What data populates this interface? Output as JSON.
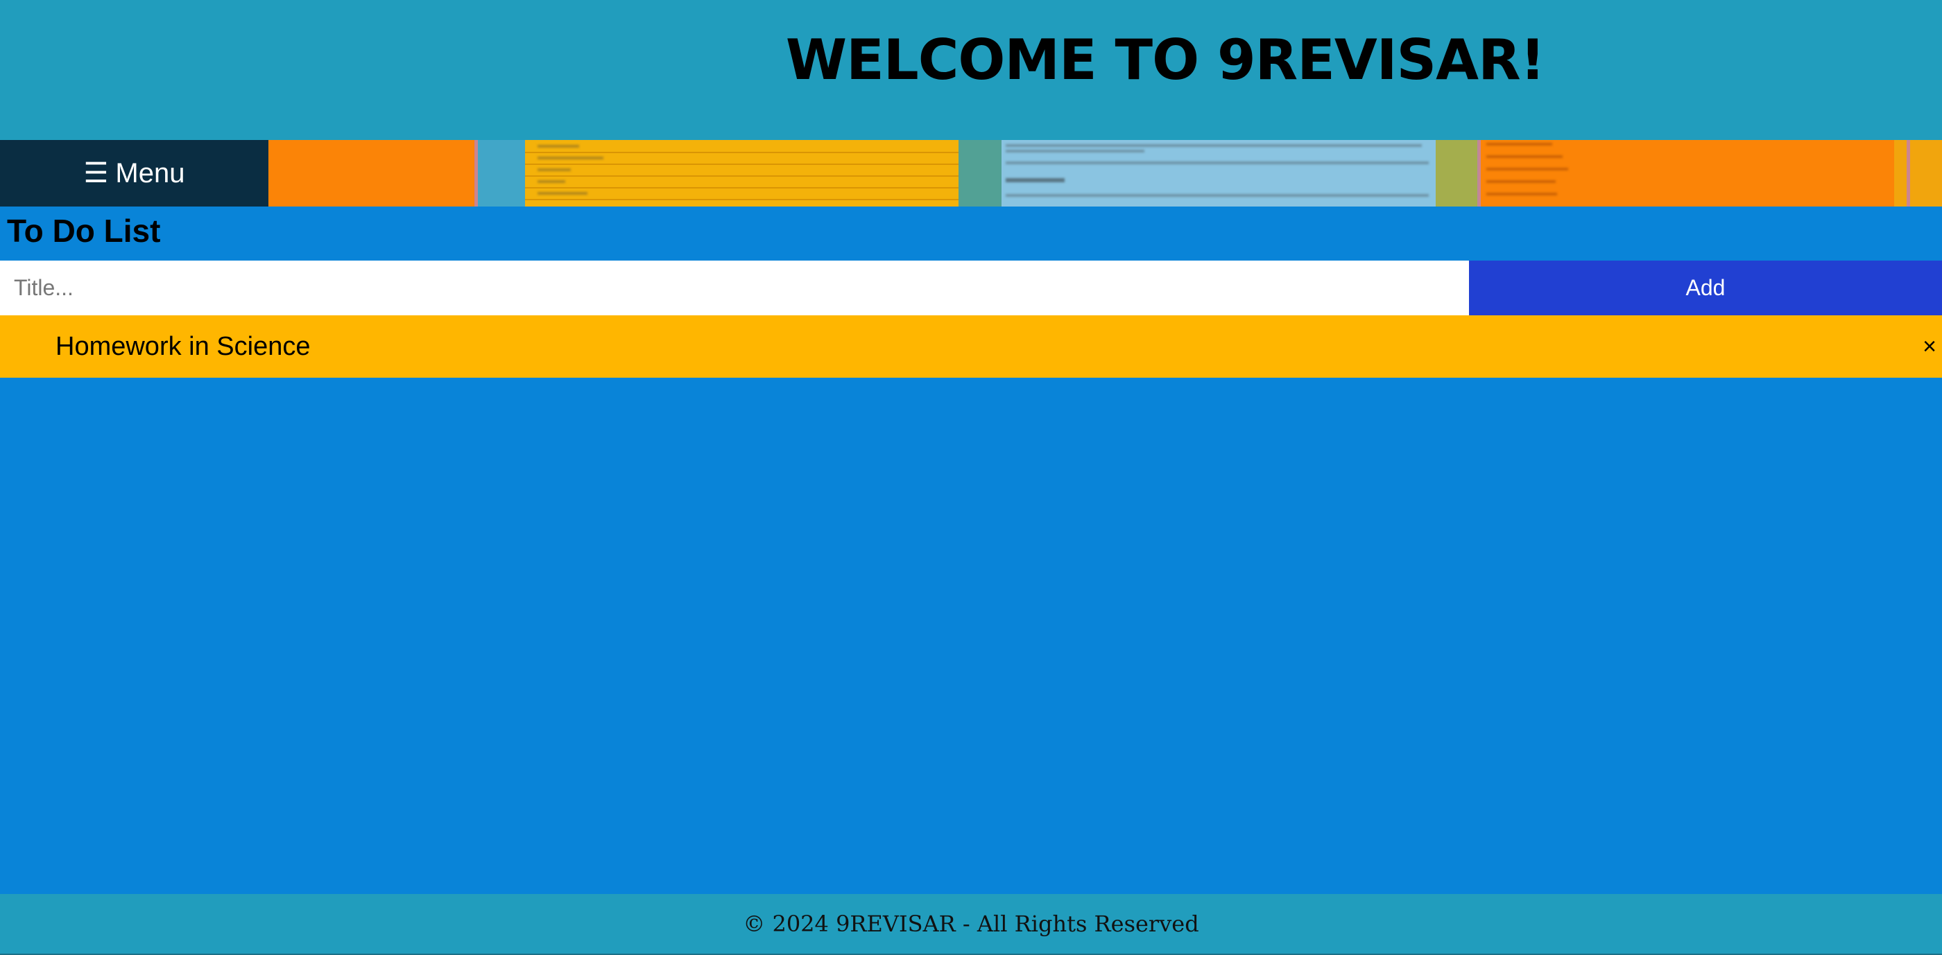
{
  "header": {
    "title": "WELCOME TO 9REVISAR!"
  },
  "nav": {
    "menu_icon": "☰",
    "menu_label": "Menu"
  },
  "todo": {
    "heading": "To Do List",
    "input_placeholder": "Title...",
    "input_value": "",
    "add_label": "Add",
    "items": [
      {
        "text": "Homework in Science",
        "close_symbol": "×"
      }
    ]
  },
  "footer": {
    "text": "© 2024 9REVISAR - All Rights Reserved"
  },
  "colors": {
    "header_bg": "#219dbd",
    "page_bg": "#0984d8",
    "menu_bg": "#0a2d42",
    "add_button_bg": "#2140d2",
    "todo_item_bg": "#ffb600"
  }
}
